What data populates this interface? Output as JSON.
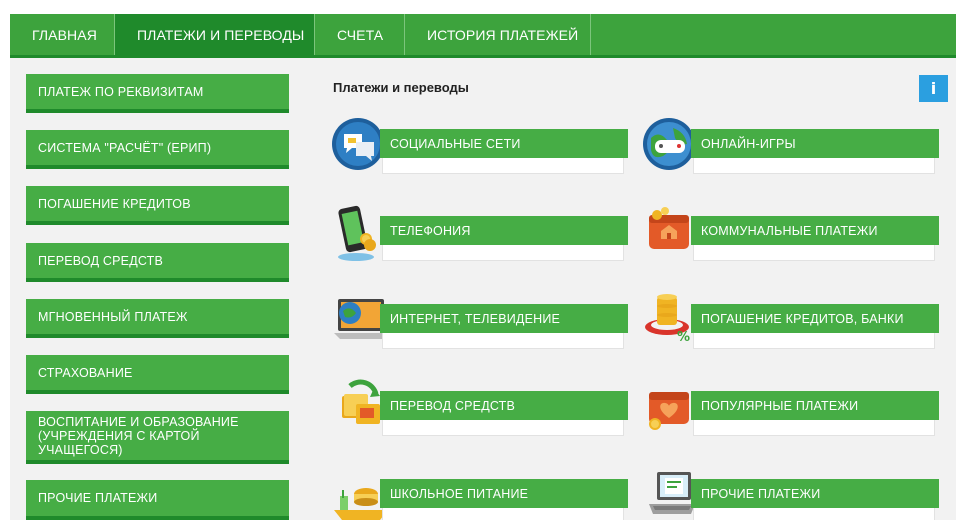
{
  "top_nav": [
    {
      "label": "ГЛАВНАЯ",
      "active": false
    },
    {
      "label": "ПЛАТЕЖИ И ПЕРЕВОДЫ",
      "active": true
    },
    {
      "label": "СЧЕТА",
      "active": false
    },
    {
      "label": "ИСТОРИЯ ПЛАТЕЖЕЙ",
      "active": false
    }
  ],
  "sidebar": {
    "items": [
      {
        "label": "ПЛАТЕЖ ПО РЕКВИЗИТАМ"
      },
      {
        "label": "СИСТЕМА \"РАСЧЁТ\" (ЕРИП)"
      },
      {
        "label": "ПОГАШЕНИЕ КРЕДИТОВ"
      },
      {
        "label": "ПЕРЕВОД СРЕДСТВ"
      },
      {
        "label": "МГНОВЕННЫЙ ПЛАТЕЖ"
      },
      {
        "label": "СТРАХОВАНИЕ"
      },
      {
        "label": "ВОСПИТАНИЕ И ОБРАЗОВАНИЕ (УЧРЕЖДЕНИЯ С КАРТОЙ УЧАЩЕГОСЯ)"
      },
      {
        "label": "ПРОЧИЕ ПЛАТЕЖИ"
      }
    ]
  },
  "panel": {
    "title": "Платежи и переводы",
    "info_label": "i"
  },
  "categories": [
    {
      "label": "СОЦИАЛЬНЫЕ СЕТИ",
      "icon": "social-networks-icon"
    },
    {
      "label": "ОНЛАЙН-ИГРЫ",
      "icon": "online-games-icon"
    },
    {
      "label": "ТЕЛЕФОНИЯ",
      "icon": "telephony-icon"
    },
    {
      "label": "КОММУНАЛЬНЫЕ ПЛАТЕЖИ",
      "icon": "utility-payments-icon"
    },
    {
      "label": "ИНТЕРНЕТ, ТЕЛЕВИДЕНИЕ",
      "icon": "internet-tv-icon"
    },
    {
      "label": "ПОГАШЕНИЕ КРЕДИТОВ, БАНКИ",
      "icon": "loans-banks-icon"
    },
    {
      "label": "ПЕРЕВОД СРЕДСТВ",
      "icon": "money-transfer-icon"
    },
    {
      "label": "ПОПУЛЯРНЫЕ ПЛАТЕЖИ",
      "icon": "popular-payments-icon"
    },
    {
      "label": "ШКОЛЬНОЕ ПИТАНИЕ",
      "icon": "school-meals-icon"
    },
    {
      "label": "ПРОЧИЕ ПЛАТЕЖИ",
      "icon": "other-payments-icon"
    }
  ],
  "colors": {
    "green": "#46ad45",
    "dark_green": "#1f8a2b",
    "info_blue": "#2b9fe0",
    "background": "#f2f2f2"
  }
}
